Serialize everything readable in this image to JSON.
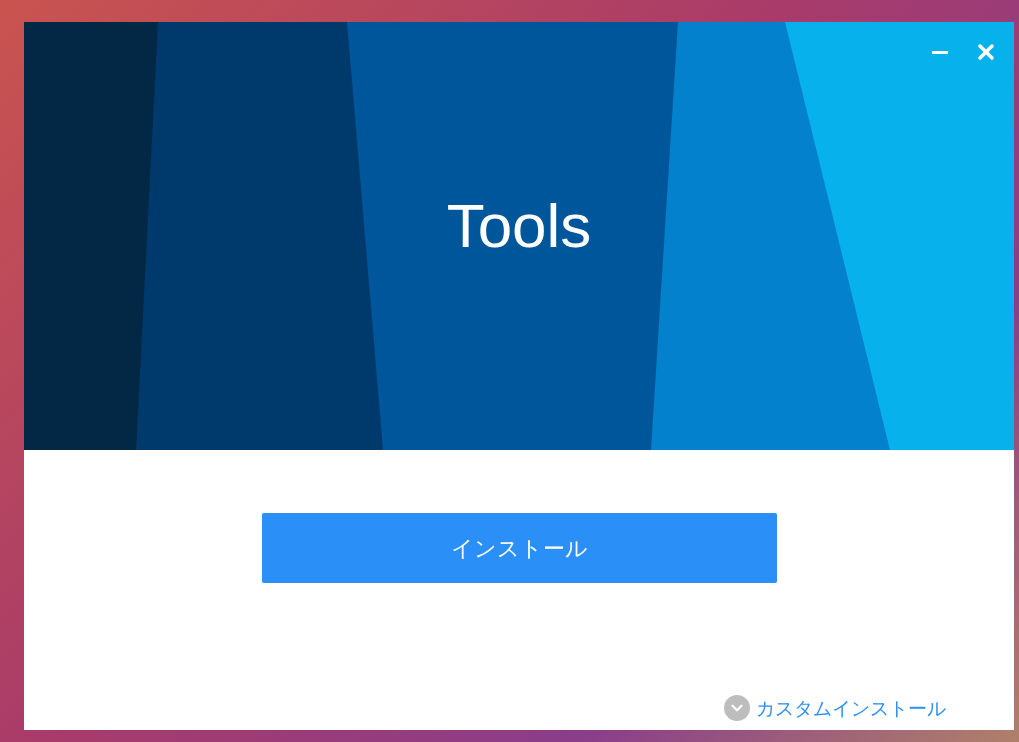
{
  "window": {
    "title": "Tools"
  },
  "install_button": {
    "label": "インストール"
  },
  "custom_install_link": {
    "label": "カスタムインストール"
  }
}
